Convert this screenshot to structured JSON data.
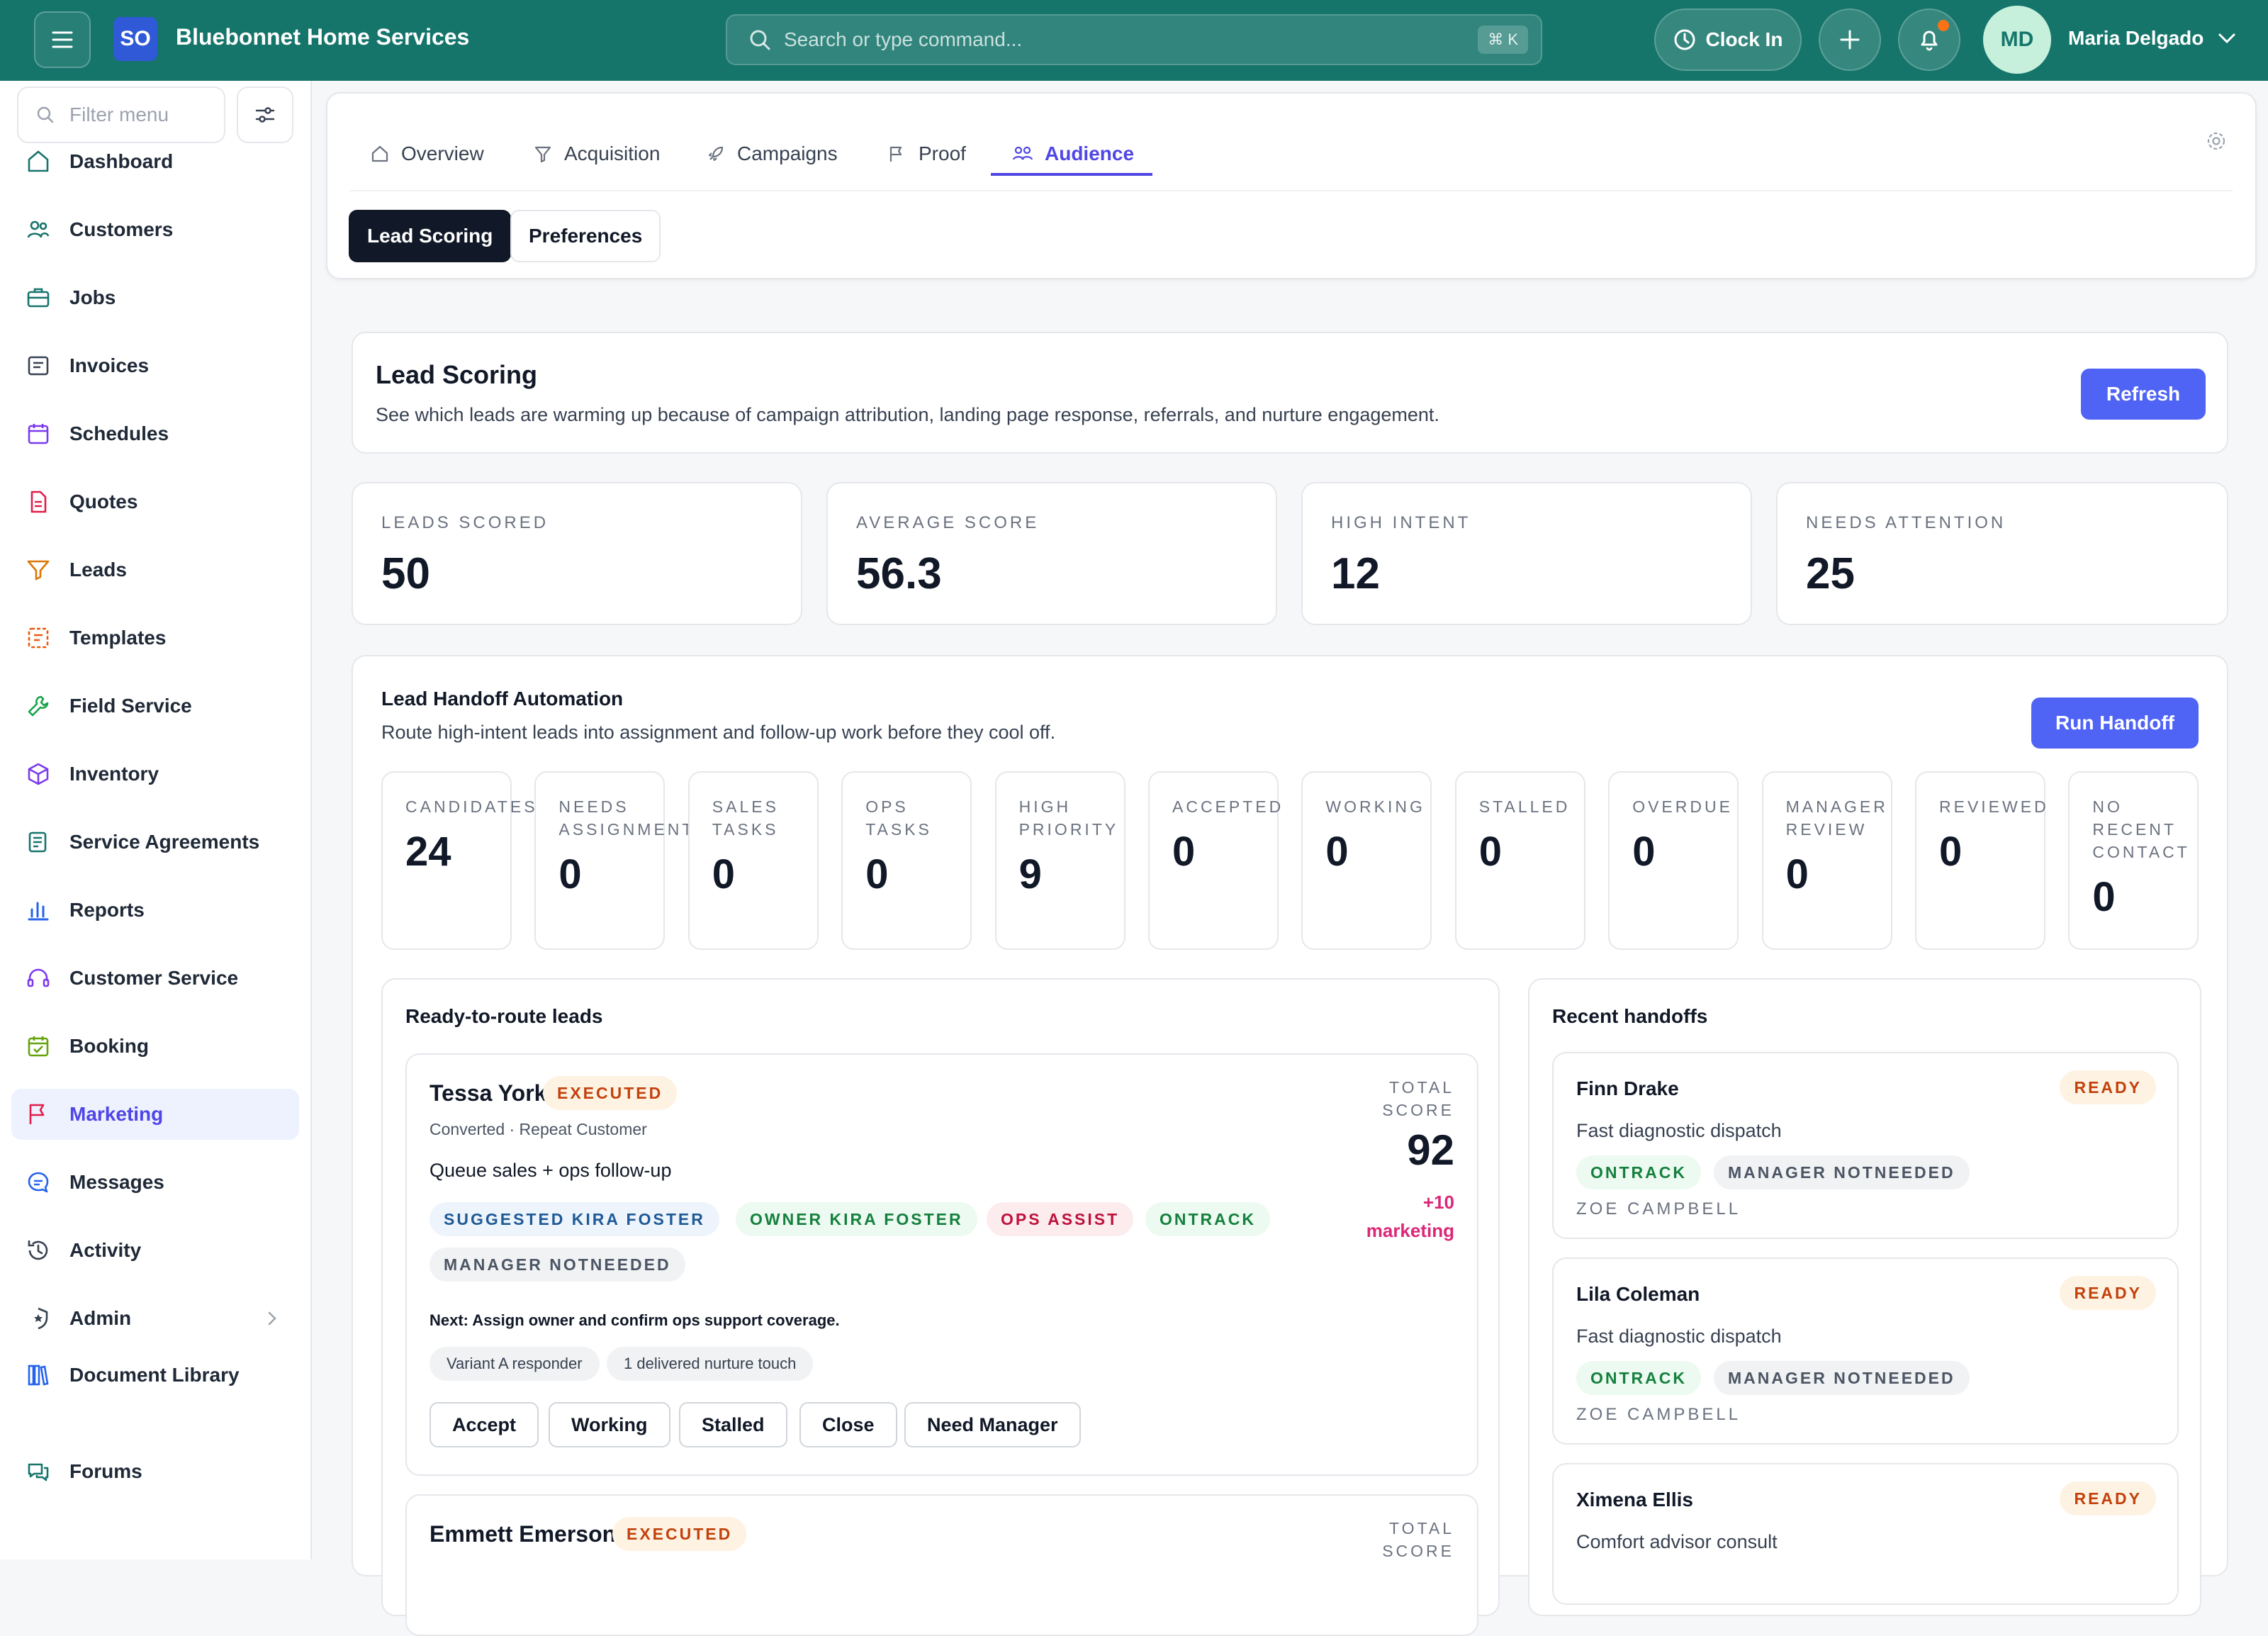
{
  "app": {
    "logo": "SO",
    "name": "Bluebonnet Home Services",
    "search_placeholder": "Search or type command...",
    "shortcut": "⌘ K",
    "clock_in": "Clock In",
    "user_initials": "MD",
    "user_name": "Maria Delgado"
  },
  "sidebar": {
    "filter_placeholder": "Filter menu",
    "items": [
      {
        "label": "Dashboard",
        "icon": "home-icon",
        "color": "#15756b"
      },
      {
        "label": "Customers",
        "icon": "users-icon",
        "color": "#15756b"
      },
      {
        "label": "Jobs",
        "icon": "briefcase-icon",
        "color": "#15756b"
      },
      {
        "label": "Invoices",
        "icon": "invoice-icon",
        "color": "#374151"
      },
      {
        "label": "Schedules",
        "icon": "calendar-icon",
        "color": "#7c3aed"
      },
      {
        "label": "Quotes",
        "icon": "document-icon",
        "color": "#e11d48"
      },
      {
        "label": "Leads",
        "icon": "funnel-icon",
        "color": "#d97706"
      },
      {
        "label": "Templates",
        "icon": "template-icon",
        "color": "#ea580c"
      },
      {
        "label": "Field Service",
        "icon": "wrench-icon",
        "color": "#16a34a"
      },
      {
        "label": "Inventory",
        "icon": "box-icon",
        "color": "#7c3aed"
      },
      {
        "label": "Service Agreements",
        "icon": "agreement-icon",
        "color": "#15756b"
      },
      {
        "label": "Reports",
        "icon": "bar-chart-icon",
        "color": "#2563eb"
      },
      {
        "label": "Customer Service",
        "icon": "headset-icon",
        "color": "#7c3aed"
      },
      {
        "label": "Booking",
        "icon": "calendar-check-icon",
        "color": "#65a30d"
      },
      {
        "label": "Marketing",
        "icon": "flag-icon",
        "color": "#e11d48"
      },
      {
        "label": "Messages",
        "icon": "chat-icon",
        "color": "#2563eb"
      },
      {
        "label": "Activity",
        "icon": "history-icon",
        "color": "#374151"
      },
      {
        "label": "Admin",
        "icon": "shield-icon",
        "color": "#374151"
      },
      {
        "label": "Document Library",
        "icon": "library-icon",
        "color": "#2563eb"
      },
      {
        "label": "Forums",
        "icon": "forum-icon",
        "color": "#15756b"
      }
    ]
  },
  "tabs": {
    "items": [
      "Overview",
      "Acquisition",
      "Campaigns",
      "Proof",
      "Audience"
    ],
    "active": "Audience",
    "subtabs": [
      "Lead Scoring",
      "Preferences"
    ]
  },
  "lead_scoring": {
    "title": "Lead Scoring",
    "description": "See which leads are warming up because of campaign attribution, landing page response, referrals, and nurture engagement.",
    "refresh": "Refresh",
    "metrics": [
      {
        "label": "LEADS SCORED",
        "value": "50"
      },
      {
        "label": "AVERAGE SCORE",
        "value": "56.3"
      },
      {
        "label": "HIGH INTENT",
        "value": "12"
      },
      {
        "label": "NEEDS ATTENTION",
        "value": "25"
      }
    ]
  },
  "handoff": {
    "title": "Lead Handoff Automation",
    "description": "Route high-intent leads into assignment and follow-up work before they cool off.",
    "run_button": "Run Handoff",
    "stats": [
      {
        "label": "Candidates",
        "value": "24"
      },
      {
        "label": "Needs Assignment",
        "value": "0"
      },
      {
        "label": "Sales Tasks",
        "value": "0"
      },
      {
        "label": "Ops Tasks",
        "value": "0"
      },
      {
        "label": "High Priority",
        "value": "9"
      },
      {
        "label": "Accepted",
        "value": "0"
      },
      {
        "label": "Working",
        "value": "0"
      },
      {
        "label": "Stalled",
        "value": "0"
      },
      {
        "label": "Overdue",
        "value": "0"
      },
      {
        "label": "Manager Review",
        "value": "0"
      },
      {
        "label": "Reviewed",
        "value": "0"
      },
      {
        "label": "No Recent Contact",
        "value": "0"
      }
    ],
    "ready_title": "Ready-to-route leads",
    "leads": [
      {
        "name": "Tessa York",
        "status": "EXECUTED",
        "sub": "Converted · Repeat Customer",
        "queue": "Queue sales + ops follow-up",
        "tags": [
          "SUGGESTED KIRA FOSTER",
          "OWNER KIRA FOSTER",
          "OPS ASSIST",
          "ONTRACK",
          "MANAGER NOTNEEDED"
        ],
        "total_label": "TOTAL SCORE",
        "total": "92",
        "delta": "+10",
        "delta_source": "marketing",
        "next": "Next: Assign owner and confirm ops support coverage.",
        "chips": [
          "Variant A responder",
          "1 delivered nurture touch"
        ],
        "actions": [
          "Accept",
          "Working",
          "Stalled",
          "Close",
          "Need Manager"
        ]
      },
      {
        "name": "Emmett Emerson",
        "status": "EXECUTED",
        "total_label": "TOTAL SCORE"
      }
    ],
    "recent_title": "Recent handoffs",
    "recent": [
      {
        "name": "Finn Drake",
        "status": "READY",
        "desc": "Fast diagnostic dispatch",
        "tags": [
          "ONTRACK",
          "MANAGER NOTNEEDED"
        ],
        "owner": "ZOE CAMPBELL"
      },
      {
        "name": "Lila Coleman",
        "status": "READY",
        "desc": "Fast diagnostic dispatch",
        "tags": [
          "ONTRACK",
          "MANAGER NOTNEEDED"
        ],
        "owner": "ZOE CAMPBELL"
      },
      {
        "name": "Ximena Ellis",
        "status": "READY",
        "desc": "Comfort advisor consult"
      }
    ]
  }
}
